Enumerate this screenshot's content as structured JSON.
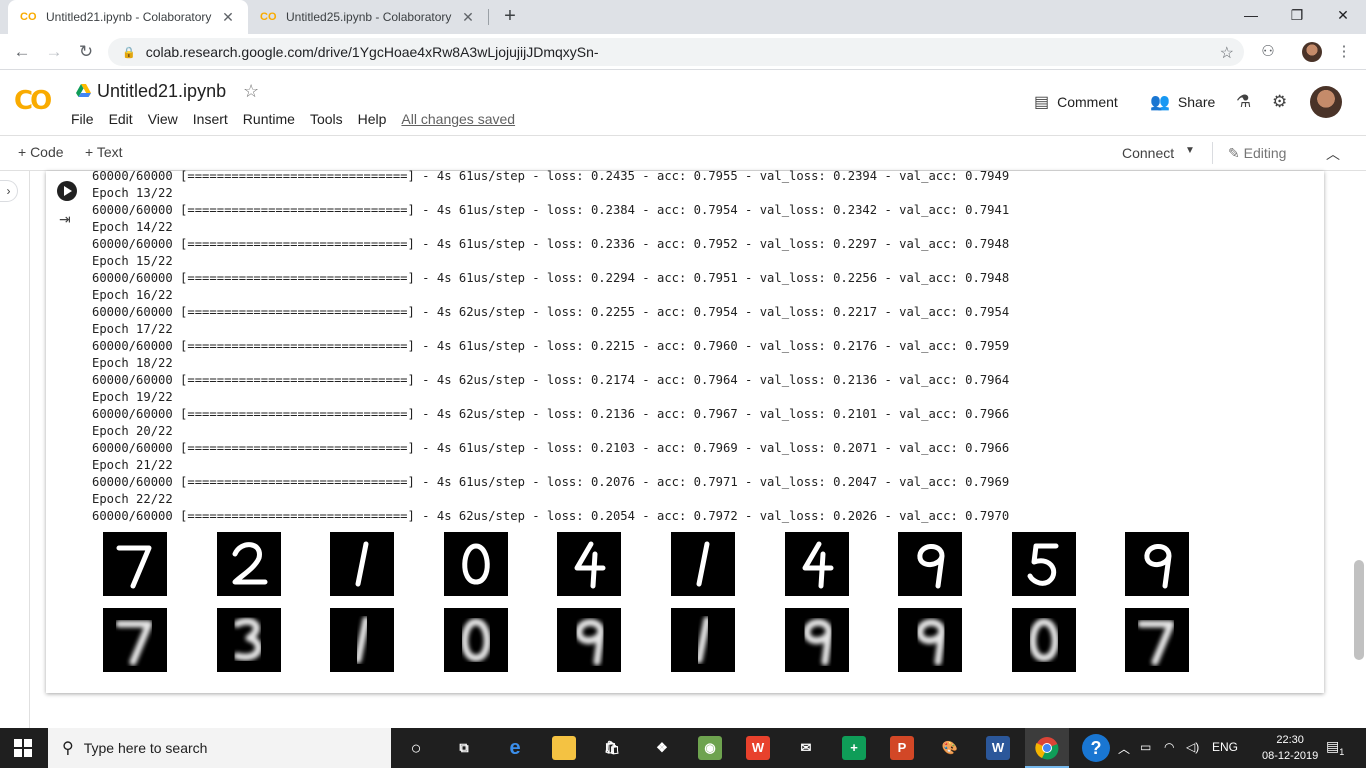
{
  "browser": {
    "tabs": [
      {
        "title": "Untitled21.ipynb - Colaboratory",
        "favicon": "CO"
      },
      {
        "title": "Untitled25.ipynb - Colaboratory",
        "favicon": "CO"
      }
    ],
    "url": "colab.research.google.com/drive/1YgcHoae4xRw8A3wLjojujijJDmqxySn-"
  },
  "colab": {
    "logo": "CO",
    "notebook_title": "Untitled21.ipynb",
    "menu": [
      "File",
      "Edit",
      "View",
      "Insert",
      "Runtime",
      "Tools",
      "Help"
    ],
    "save_status": "All changes saved",
    "comment_label": "Comment",
    "share_label": "Share",
    "add_code_label": "+ Code",
    "add_text_label": "+ Text",
    "connect_label": "Connect",
    "editing_label": "Editing"
  },
  "output_lines": [
    "60000/60000 [==============================] - 4s 61us/step - loss: 0.2435 - acc: 0.7955 - val_loss: 0.2394 - val_acc: 0.7949",
    "Epoch 13/22",
    "60000/60000 [==============================] - 4s 61us/step - loss: 0.2384 - acc: 0.7954 - val_loss: 0.2342 - val_acc: 0.7941",
    "Epoch 14/22",
    "60000/60000 [==============================] - 4s 61us/step - loss: 0.2336 - acc: 0.7952 - val_loss: 0.2297 - val_acc: 0.7948",
    "Epoch 15/22",
    "60000/60000 [==============================] - 4s 61us/step - loss: 0.2294 - acc: 0.7951 - val_loss: 0.2256 - val_acc: 0.7948",
    "Epoch 16/22",
    "60000/60000 [==============================] - 4s 62us/step - loss: 0.2255 - acc: 0.7954 - val_loss: 0.2217 - val_acc: 0.7954",
    "Epoch 17/22",
    "60000/60000 [==============================] - 4s 61us/step - loss: 0.2215 - acc: 0.7960 - val_loss: 0.2176 - val_acc: 0.7959",
    "Epoch 18/22",
    "60000/60000 [==============================] - 4s 62us/step - loss: 0.2174 - acc: 0.7964 - val_loss: 0.2136 - val_acc: 0.7964",
    "Epoch 19/22",
    "60000/60000 [==============================] - 4s 62us/step - loss: 0.2136 - acc: 0.7967 - val_loss: 0.2101 - val_acc: 0.7966",
    "Epoch 20/22",
    "60000/60000 [==============================] - 4s 61us/step - loss: 0.2103 - acc: 0.7969 - val_loss: 0.2071 - val_acc: 0.7966",
    "Epoch 21/22",
    "60000/60000 [==============================] - 4s 61us/step - loss: 0.2076 - acc: 0.7971 - val_loss: 0.2047 - val_acc: 0.7969",
    "Epoch 22/22",
    "60000/60000 [==============================] - 4s 62us/step - loss: 0.2054 - acc: 0.7972 - val_loss: 0.2026 - val_acc: 0.7970"
  ],
  "digits": {
    "original": [
      "7",
      "2",
      "1",
      "0",
      "4",
      "1",
      "4",
      "9",
      "5",
      "9"
    ],
    "reconstructed": [
      "7",
      "3",
      "1",
      "0",
      "9",
      "1",
      "9",
      "9",
      "0",
      "7"
    ]
  },
  "taskbar": {
    "search_placeholder": "Type here to search",
    "language": "ENG",
    "time": "22:30",
    "date": "08-12-2019",
    "notifications": "1"
  }
}
